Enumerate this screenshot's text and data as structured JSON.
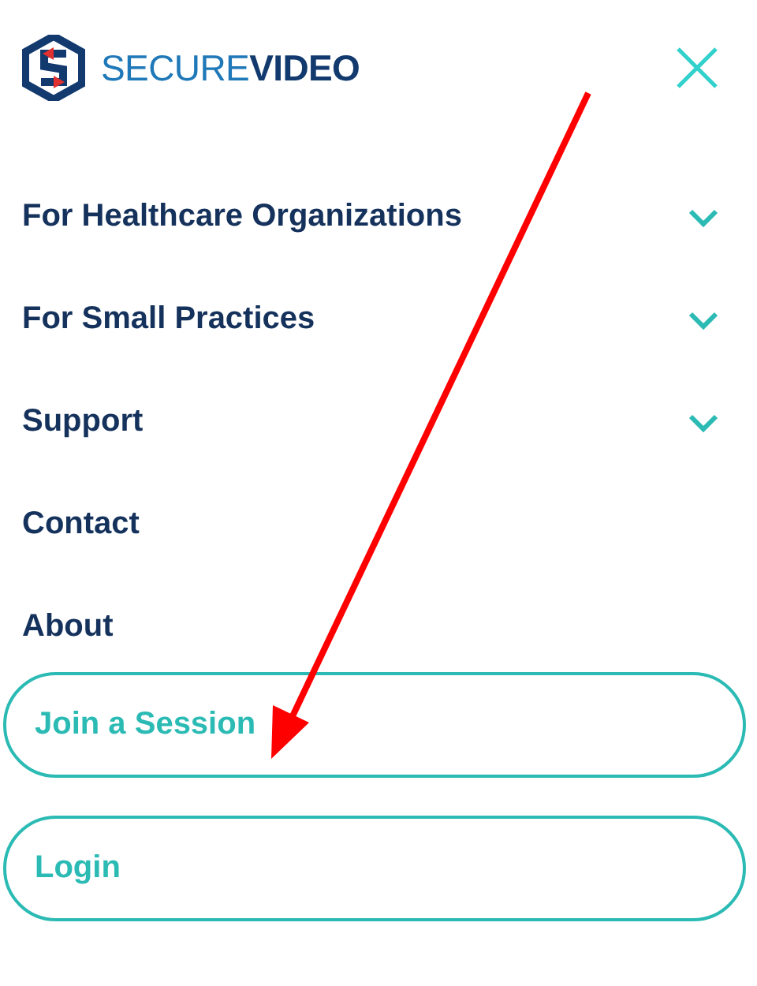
{
  "header": {
    "logo_text": "SECURE**VIDEO**"
  },
  "menu": [
    {
      "label": "For Healthcare Organizations",
      "expandable": true
    },
    {
      "label": "For Small Practices",
      "expandable": true
    },
    {
      "label": "Support",
      "expandable": true
    },
    {
      "label": "Contact",
      "expandable": false
    },
    {
      "label": "About",
      "expandable": false
    }
  ],
  "buttons": [
    "Join a Session",
    "Login"
  ]
}
